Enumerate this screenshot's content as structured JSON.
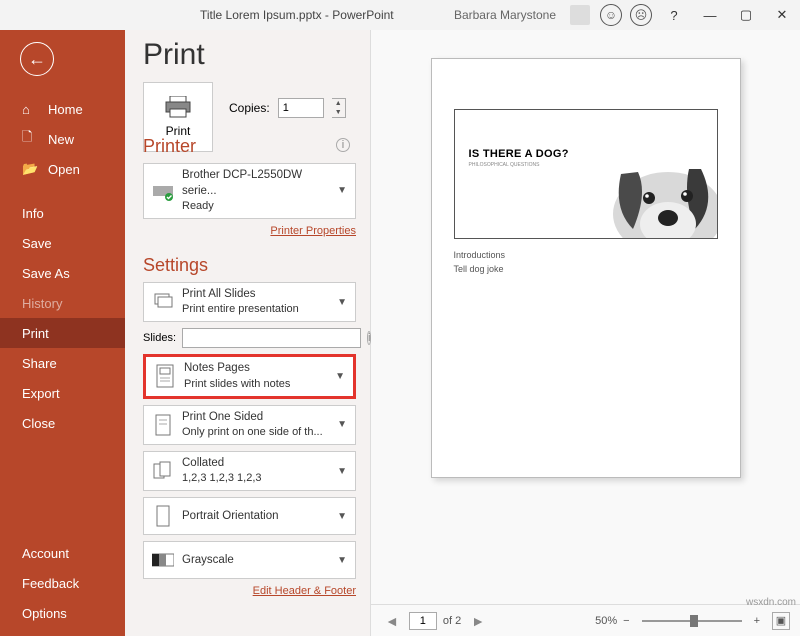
{
  "titlebar": {
    "title": "Title Lorem Ipsum.pptx  -  PowerPoint",
    "user": "Barbara Marystone",
    "help": "?"
  },
  "sidebar": {
    "home": "Home",
    "new": "New",
    "open": "Open",
    "info": "Info",
    "save": "Save",
    "saveas": "Save As",
    "history": "History",
    "print": "Print",
    "share": "Share",
    "export": "Export",
    "close": "Close",
    "account": "Account",
    "feedback": "Feedback",
    "options": "Options"
  },
  "panel": {
    "heading": "Print",
    "print_btn": "Print",
    "copies_label": "Copies:",
    "copies_value": "1",
    "printer_heading": "Printer",
    "printer_name": "Brother DCP-L2550DW serie...",
    "printer_status": "Ready",
    "printer_props": "Printer Properties",
    "settings_heading": "Settings",
    "scope_t": "Print All Slides",
    "scope_s": "Print entire presentation",
    "slides_label": "Slides:",
    "layout_t": "Notes Pages",
    "layout_s": "Print slides with notes",
    "sides_t": "Print One Sided",
    "sides_s": "Only print on one side of th...",
    "collate_t": "Collated",
    "collate_s": "1,2,3    1,2,3    1,2,3",
    "orient": "Portrait Orientation",
    "color": "Grayscale",
    "hf_link": "Edit Header & Footer"
  },
  "preview": {
    "headline": "IS THERE A DOG?",
    "sub": "PHILOSOPHICAL QUESTIONS",
    "note1": "Introductions",
    "note2": "Tell  dog joke"
  },
  "status": {
    "page_current": "1",
    "page_total": "of 2",
    "zoom": "50%",
    "watermark": "wsxdn.com"
  }
}
